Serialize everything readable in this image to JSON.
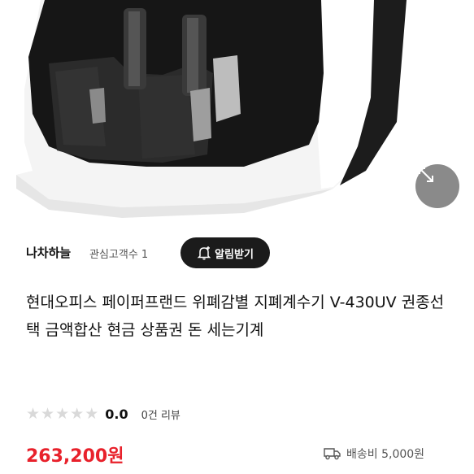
{
  "product_image": {
    "alt": "현대오피스 지폐계수기 V-430UV"
  },
  "expand_icon": "expand-arrows-icon",
  "store": {
    "name": "나차하늘",
    "fans": "관심고객수 1",
    "alarm_label": "알림받기",
    "alarm_icon": "bell-plus-icon"
  },
  "product": {
    "title": "현대오피스 페이퍼프랜드 위폐감별 지폐계수기 V-430UV 권종선택 금액합산 현금 상품권 돈 세는기계",
    "rating": {
      "stars": 0,
      "max_stars": 5,
      "value": "0.0",
      "review_count": "0건 리뷰"
    },
    "price": "263,200원",
    "shipping": "배송비 5,000원",
    "shipping_icon": "truck-icon"
  },
  "colors": {
    "price": "#e8212b",
    "alarm_button_bg": "#1b1b1b",
    "star_empty": "#d9d9d9",
    "expand_button_bg": "#8a8a8a"
  }
}
